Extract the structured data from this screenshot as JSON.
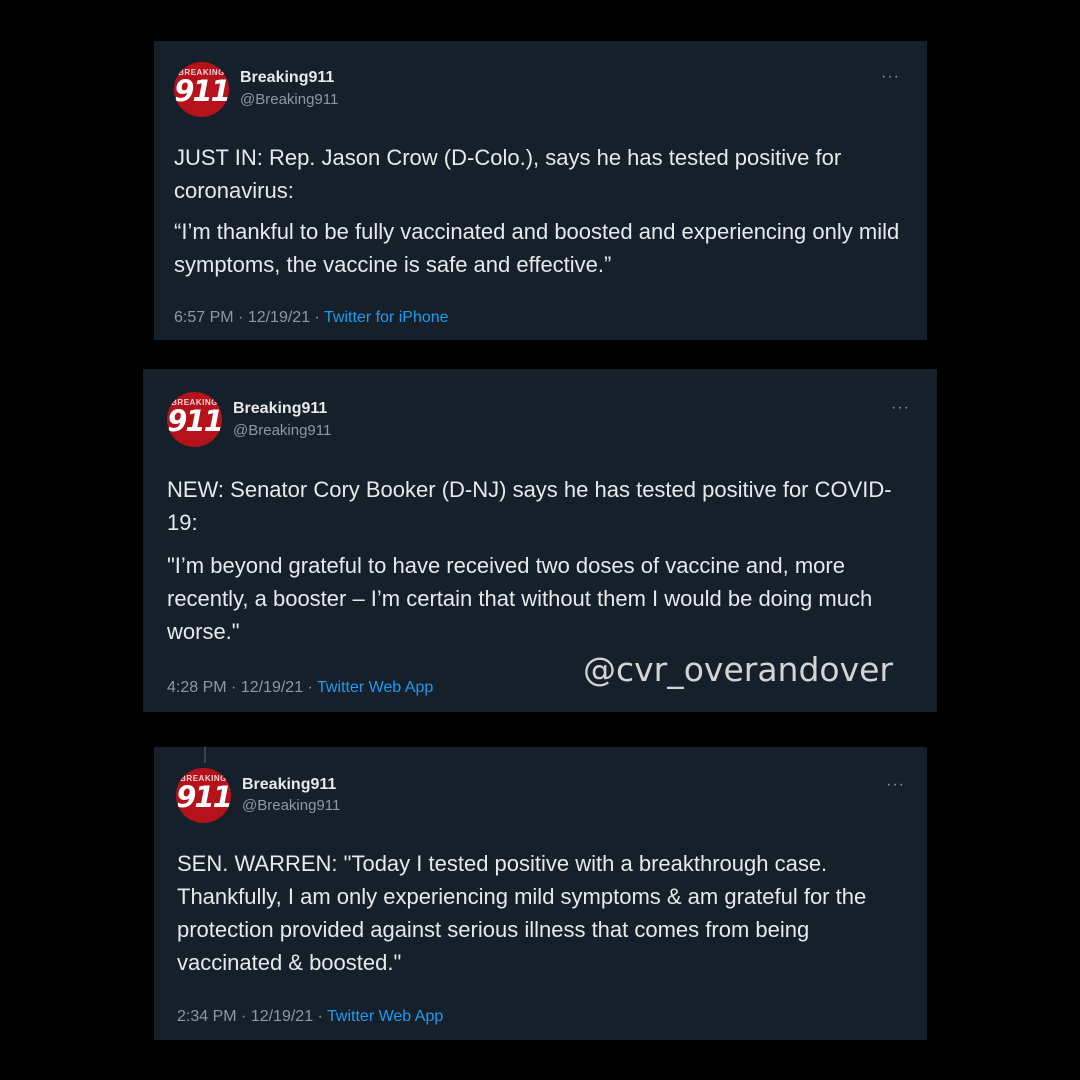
{
  "tweets": [
    {
      "account": {
        "avatar_top": "BREAKING",
        "avatar_num": "911",
        "name": "Breaking911",
        "handle": "@Breaking911"
      },
      "more": "···",
      "paragraphs": [
        "JUST IN: Rep. Jason Crow (D-Colo.), says he has tested positive for coronavirus:",
        "“I’m thankful to be fully vaccinated and boosted and experiencing only mild symptoms, the vaccine is safe and effective.”"
      ],
      "time": "6:57 PM",
      "date": "12/19/21",
      "source": "Twitter for iPhone"
    },
    {
      "account": {
        "avatar_top": "BREAKING",
        "avatar_num": "911",
        "name": "Breaking911",
        "handle": "@Breaking911"
      },
      "more": "···",
      "paragraphs": [
        "NEW: Senator Cory Booker (D-NJ) says he has tested positive for COVID-19:",
        "\"I’m beyond grateful to have received two doses of vaccine and, more recently, a booster – I’m certain that without them I would be doing much worse.\""
      ],
      "time": "4:28 PM",
      "date": "12/19/21",
      "source": "Twitter Web App"
    },
    {
      "account": {
        "avatar_top": "BREAKING",
        "avatar_num": "911",
        "name": "Breaking911",
        "handle": "@Breaking911"
      },
      "more": "···",
      "paragraphs": [
        "SEN. WARREN: \"Today I tested positive with a breakthrough case. Thankfully, I am only experiencing mild symptoms & am grateful for the protection provided against serious illness that comes from being vaccinated & boosted.\""
      ],
      "time": "2:34 PM",
      "date": "12/19/21",
      "source": "Twitter Web App"
    }
  ],
  "watermark": "@cvr_overandover",
  "colors": {
    "card_bg": "#15202b",
    "link": "#1d9bf0",
    "avatar": "#b5121b"
  }
}
